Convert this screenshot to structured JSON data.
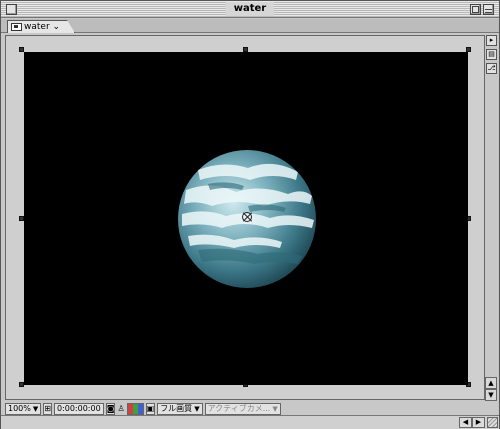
{
  "window": {
    "title": "water"
  },
  "tab": {
    "label": "water ⌄"
  },
  "viewer": {
    "zoom": "100%",
    "timecode": "0:00:00:00",
    "quality": "フル画質",
    "camera": "アクティブカメ..."
  },
  "icons": {
    "close": "close-icon",
    "zoom": "zoom-box-icon",
    "collapse": "collapse-icon",
    "comp": "composition-icon"
  },
  "colors": {
    "background": "#000000",
    "planet_light": "#cfe9ee",
    "planet_dark": "#163a45",
    "chrome": "#c8c8c8"
  }
}
